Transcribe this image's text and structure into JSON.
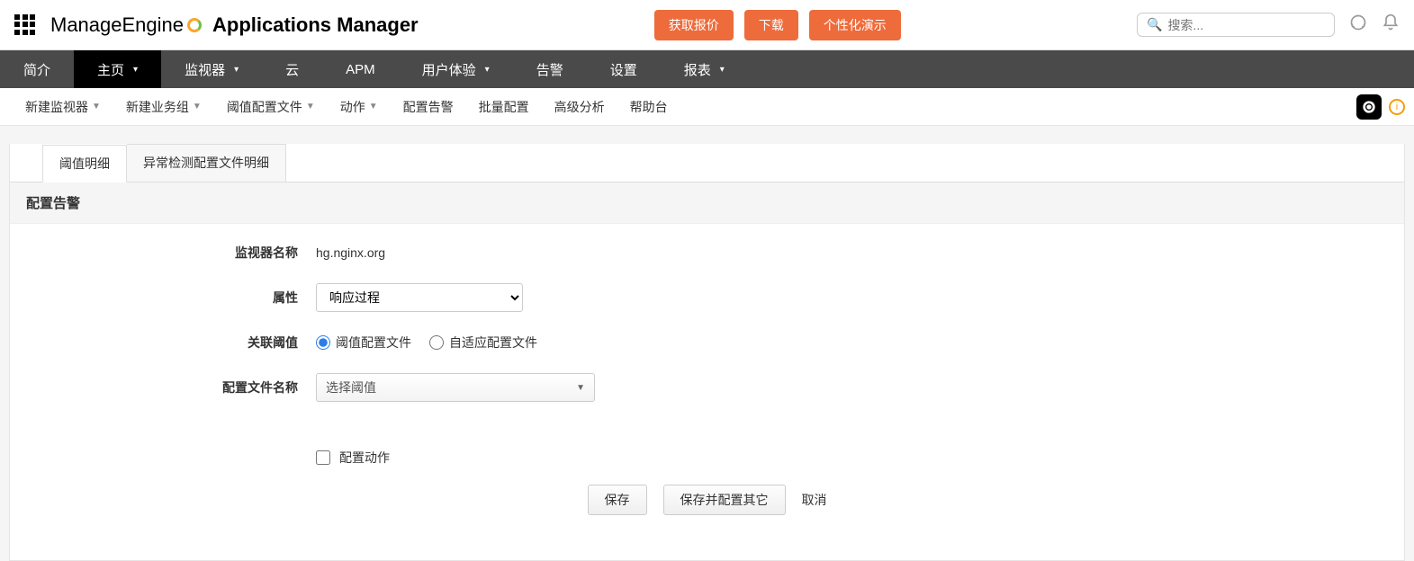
{
  "header": {
    "brand_left": "ManageEngine",
    "brand_right": "Applications Manager",
    "buttons": {
      "quote": "获取报价",
      "download": "下载",
      "demo": "个性化演示"
    },
    "search_placeholder": "搜索..."
  },
  "nav": {
    "items": [
      {
        "label": "简介",
        "caret": false
      },
      {
        "label": "主页",
        "caret": true,
        "active": true
      },
      {
        "label": "监视器",
        "caret": true
      },
      {
        "label": "云",
        "caret": false
      },
      {
        "label": "APM",
        "caret": false
      },
      {
        "label": "用户体验",
        "caret": true
      },
      {
        "label": "告警",
        "caret": false
      },
      {
        "label": "设置",
        "caret": false
      },
      {
        "label": "报表",
        "caret": true
      }
    ]
  },
  "subnav": {
    "items": [
      {
        "label": "新建监视器",
        "caret": true
      },
      {
        "label": "新建业务组",
        "caret": true
      },
      {
        "label": "阈值配置文件",
        "caret": true
      },
      {
        "label": "动作",
        "caret": true
      },
      {
        "label": "配置告警",
        "caret": false
      },
      {
        "label": "批量配置",
        "caret": false
      },
      {
        "label": "高级分析",
        "caret": false
      },
      {
        "label": "帮助台",
        "caret": false
      }
    ]
  },
  "tabs": {
    "items": [
      {
        "label": "阈值明细",
        "active": true
      },
      {
        "label": "异常检测配置文件明细",
        "active": false
      }
    ]
  },
  "section_title": "配置告警",
  "form": {
    "monitor_name_label": "监视器名称",
    "monitor_name_value": "hg.nginx.org",
    "attribute_label": "属性",
    "attribute_value": "响应过程",
    "assoc_threshold_label": "关联阈值",
    "assoc_option1": "阈值配置文件",
    "assoc_option2": "自适应配置文件",
    "profile_name_label": "配置文件名称",
    "profile_name_value": "选择阈值",
    "config_action_label": "配置动作"
  },
  "actions": {
    "save": "保存",
    "save_config": "保存并配置其它",
    "cancel": "取消"
  }
}
